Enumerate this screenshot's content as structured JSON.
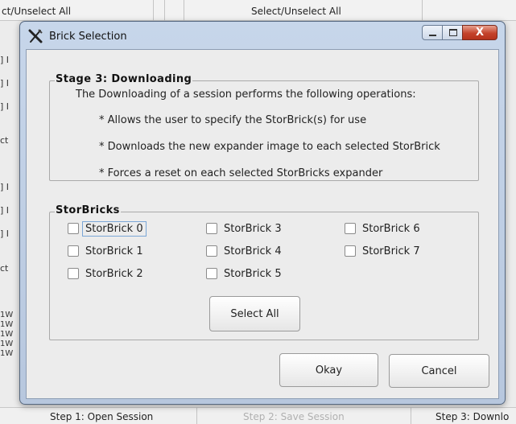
{
  "background": {
    "top_left_text": "ct/Unselect All",
    "top_center_text": "Select/Unselect All",
    "side_items": [
      "] I",
      "] I",
      "] I",
      "ct",
      "] I",
      "] I",
      "] I",
      "ct",
      "1W",
      "1W",
      "1W",
      "1W",
      "1W"
    ],
    "steps": [
      {
        "label": "Step 1: Open Session",
        "enabled": true
      },
      {
        "label": "Step 2: Save Session",
        "enabled": false
      },
      {
        "label": "Step 3: Downlo",
        "enabled": true
      }
    ]
  },
  "dialog": {
    "title": "Brick Selection",
    "app_icon": "x-tool-icon",
    "window_buttons": {
      "minimize": "minimize-icon",
      "maximize": "maximize-icon",
      "close": "close-icon",
      "close_glyph": "X"
    },
    "stage": {
      "title": "Stage 3: Downloading",
      "description": "The Downloading of a session performs the following operations:",
      "bullets": [
        "* Allows the user to specify the StorBrick(s) for use",
        "* Downloads the new expander image to each selected StorBrick",
        "* Forces a reset on each selected StorBricks expander"
      ]
    },
    "storbricks": {
      "title": "StorBricks",
      "items": [
        {
          "label": "StorBrick 0",
          "checked": false,
          "focused": true
        },
        {
          "label": "StorBrick 1",
          "checked": false
        },
        {
          "label": "StorBrick 2",
          "checked": false
        },
        {
          "label": "StorBrick 3",
          "checked": false
        },
        {
          "label": "StorBrick 4",
          "checked": false
        },
        {
          "label": "StorBrick 5",
          "checked": false
        },
        {
          "label": "StorBrick 6",
          "checked": false
        },
        {
          "label": "StorBrick 7",
          "checked": false
        }
      ],
      "select_all_label": "Select All"
    },
    "okay_label": "Okay",
    "cancel_label": "Cancel"
  }
}
